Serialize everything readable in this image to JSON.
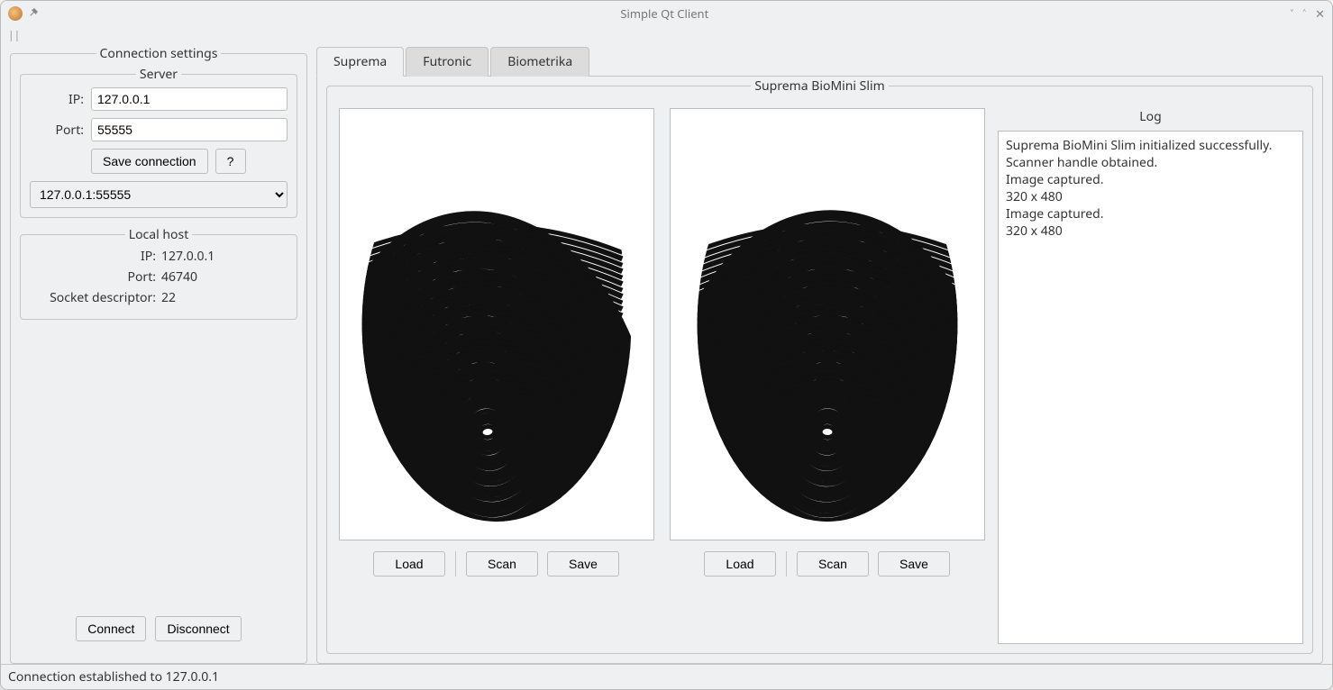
{
  "window": {
    "title": "Simple Qt Client"
  },
  "connection_settings": {
    "title": "Connection settings",
    "server": {
      "title": "Server",
      "ip_label": "IP:",
      "ip_value": "127.0.0.1",
      "port_label": "Port:",
      "port_value": "55555",
      "save_btn": "Save connection",
      "help_btn": "?",
      "saved_selected": "127.0.0.1:55555"
    },
    "local_host": {
      "title": "Local host",
      "ip_label": "IP:",
      "ip_value": "127.0.0.1",
      "port_label": "Port:",
      "port_value": "46740",
      "socket_label": "Socket descriptor:",
      "socket_value": "22"
    },
    "connect_btn": "Connect",
    "disconnect_btn": "Disconnect"
  },
  "tabs": {
    "items": [
      "Suprema",
      "Futronic",
      "Biometrika"
    ],
    "active_index": 0
  },
  "device": {
    "title": "Suprema BioMini Slim",
    "panel1": {
      "load": "Load",
      "scan": "Scan",
      "save": "Save"
    },
    "panel2": {
      "load": "Load",
      "scan": "Scan",
      "save": "Save"
    },
    "log_label": "Log",
    "log_text": "Suprema BioMini Slim initialized successfully.\nScanner handle obtained.\nImage captured.\n320 x 480\nImage captured.\n320 x 480"
  },
  "statusbar": {
    "text": "Connection established to 127.0.0.1"
  }
}
